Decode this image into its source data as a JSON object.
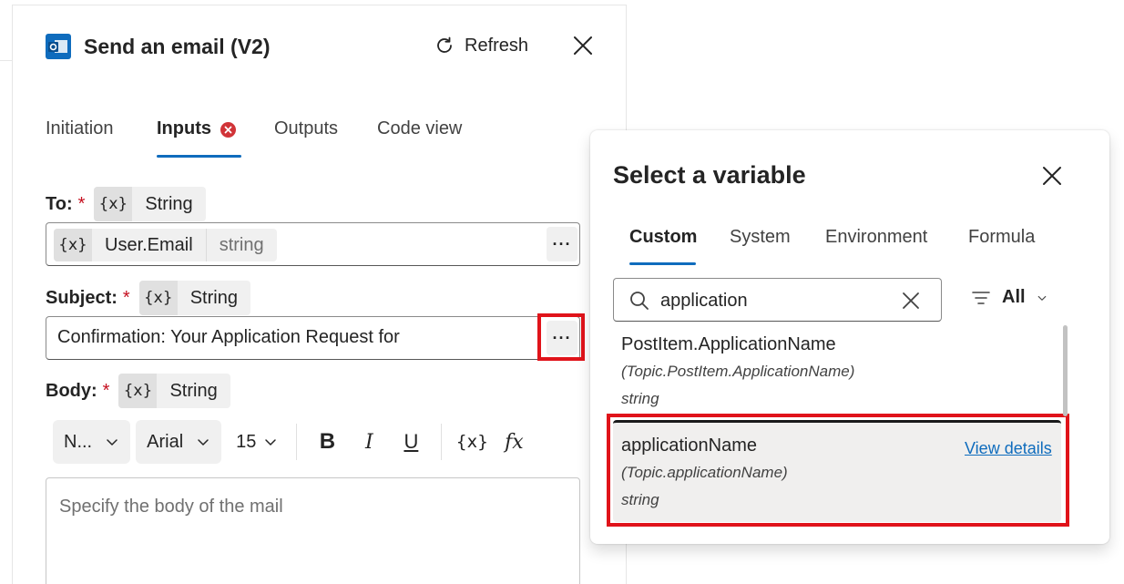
{
  "panel": {
    "title": "Send an email (V2)",
    "refresh_label": "Refresh",
    "tabs": [
      {
        "label": "Initiation"
      },
      {
        "label": "Inputs"
      },
      {
        "label": "Outputs"
      },
      {
        "label": "Code view"
      }
    ]
  },
  "fields": {
    "to": {
      "label": "To:",
      "required_mark": "*",
      "type_icon": "{x}",
      "type_name": "String",
      "token_icon": "{x}",
      "token_name": "User.Email",
      "token_type": "string",
      "more": "···"
    },
    "subject": {
      "label": "Subject:",
      "required_mark": "*",
      "type_icon": "{x}",
      "type_name": "String",
      "value": "Confirmation: Your Application Request for",
      "more": "···"
    },
    "body": {
      "label": "Body:",
      "required_mark": "*",
      "type_icon": "{x}",
      "type_name": "String",
      "placeholder": "Specify the body of the mail"
    }
  },
  "toolbar": {
    "paragraph": "N...",
    "font": "Arial",
    "size": "15",
    "bold": "B",
    "italic": "I",
    "underline": "U",
    "variable": "{x}",
    "formula": "fx"
  },
  "picker": {
    "title": "Select a variable",
    "tabs": [
      {
        "label": "Custom"
      },
      {
        "label": "System"
      },
      {
        "label": "Environment"
      },
      {
        "label": "Formula"
      }
    ],
    "search_value": "application",
    "filter_label": "All",
    "items": [
      {
        "name": "PostItem.ApplicationName",
        "path": "(Topic.PostItem.ApplicationName)",
        "type": "string"
      },
      {
        "name": "applicationName",
        "path": "(Topic.applicationName)",
        "type": "string",
        "action": "View details"
      }
    ]
  },
  "colors": {
    "accent": "#0f6cbd",
    "highlight": "#e0131a",
    "error": "#d13438"
  }
}
